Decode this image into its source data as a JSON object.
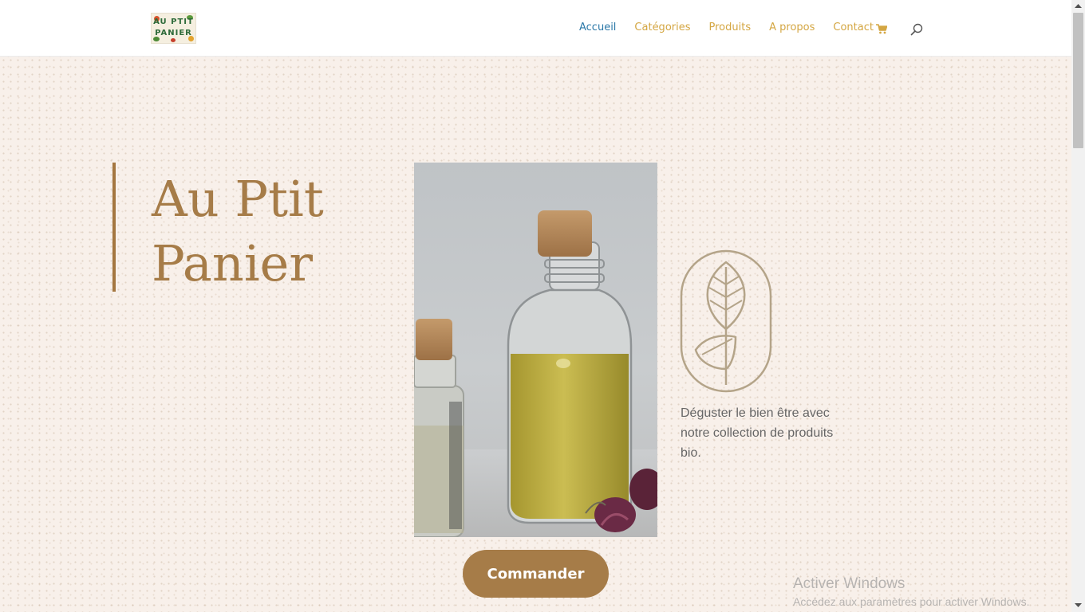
{
  "header": {
    "logo_lines": [
      "AU PTIT",
      "PANIER"
    ],
    "nav": [
      {
        "label": "Accueil",
        "active": true
      },
      {
        "label": "Catégories",
        "active": false
      },
      {
        "label": "Produits",
        "active": false
      },
      {
        "label": "A propos",
        "active": false
      },
      {
        "label": "Contact",
        "active": false
      }
    ],
    "icons": {
      "cart": "cart-icon",
      "search": "search-icon"
    }
  },
  "hero": {
    "title": "Au Ptit Panier",
    "tagline": "Déguster le bien être avec notre collection de produits bio.",
    "cta_label": "Commander",
    "emblem_icon": "leaf-emblem-icon"
  },
  "watermark": {
    "title": "Activer Windows",
    "subtitle": "Accédez aux paramètres pour activer Windows."
  },
  "colors": {
    "accent": "#a67c48",
    "nav_link": "#d4a642",
    "nav_active": "#2b78a8",
    "background": "#f8f0ea"
  }
}
